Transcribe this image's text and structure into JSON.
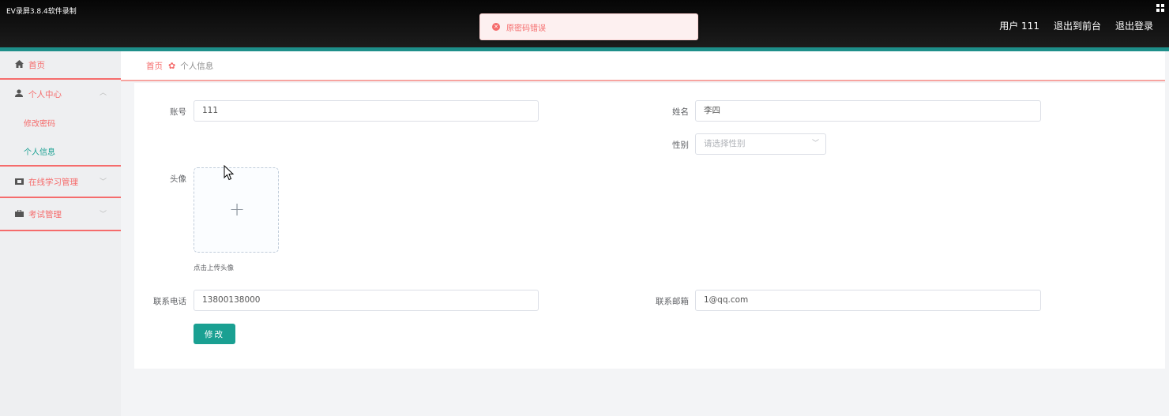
{
  "watermark": "EV录屏3.8.4软件录制",
  "header": {
    "user_label": "用户 111",
    "front_link": "退出到前台",
    "logout_link": "退出登录"
  },
  "toast": {
    "message": "原密码错误",
    "color": "#f56c6c"
  },
  "sidebar": {
    "home": "首页",
    "personal_center": "个人中心",
    "change_password": "修改密码",
    "personal_info": "个人信息",
    "online_learning": "在线学习管理",
    "exam_mgmt": "考试管理"
  },
  "breadcrumb": {
    "home": "首页",
    "current": "个人信息"
  },
  "form": {
    "account_label": "账号",
    "account_value": "111",
    "name_label": "姓名",
    "name_value": "李四",
    "gender_label": "性别",
    "gender_placeholder": "请选择性别",
    "avatar_label": "头像",
    "avatar_tip": "点击上传头像",
    "phone_label": "联系电话",
    "phone_value": "13800138000",
    "email_label": "联系邮箱",
    "email_value": "1@qq.com",
    "submit_label": "修改"
  },
  "colors": {
    "accent": "#1aa092",
    "danger": "#f56c6c",
    "header": "#111111"
  }
}
